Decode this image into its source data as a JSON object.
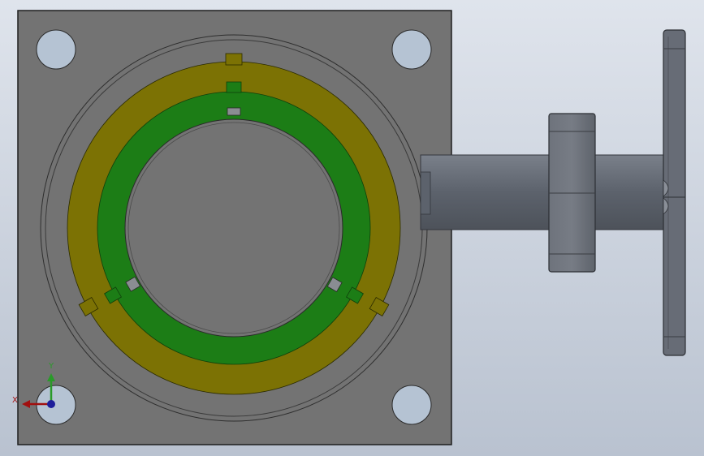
{
  "triad": {
    "x_label": "X",
    "y_label": "Y"
  },
  "colors": {
    "background_top": "#dfe4ec",
    "background_bottom": "#b9c2d0",
    "housing": "#737373",
    "housing_edge": "#1e1e1e",
    "outer_ring": "#7c7204",
    "inner_ring": "#1c7d16",
    "hole": "#b5c3d3",
    "shaft": "#5a606b",
    "hub": "#676c76",
    "handwheel": "#676c76",
    "axis_x": "#a10f0f",
    "axis_y": "#2a9a2a",
    "axis_z": "#1d1d9a"
  }
}
